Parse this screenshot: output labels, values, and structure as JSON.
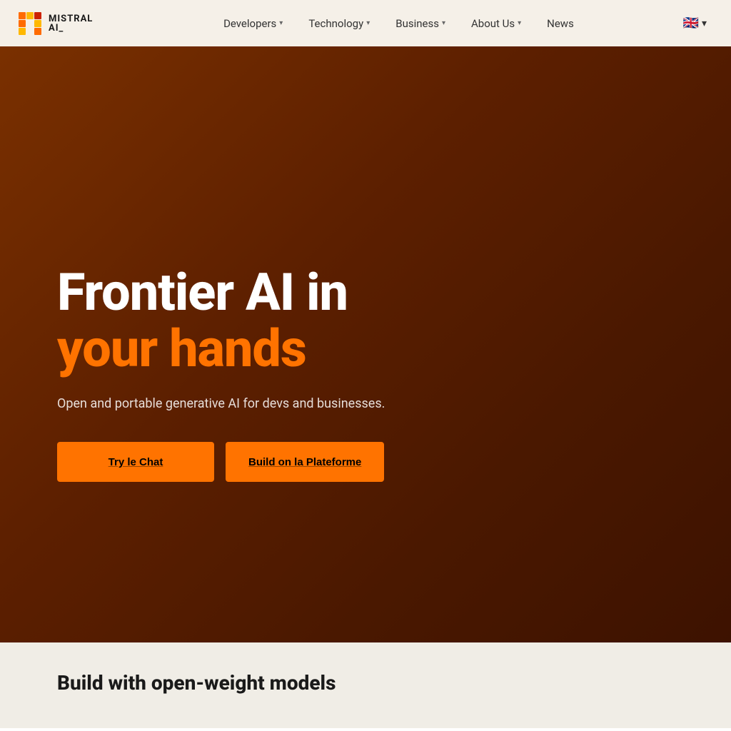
{
  "navbar": {
    "logo": {
      "title": "MISTRAL",
      "subtitle": "AI_"
    },
    "nav_items": [
      {
        "label": "Developers",
        "has_dropdown": true
      },
      {
        "label": "Technology",
        "has_dropdown": true
      },
      {
        "label": "Business",
        "has_dropdown": true
      },
      {
        "label": "About Us",
        "has_dropdown": true
      },
      {
        "label": "News",
        "has_dropdown": false
      }
    ],
    "language": {
      "code": "EN",
      "flag_emoji": "🇬🇧"
    }
  },
  "hero": {
    "title_line1": "Frontier AI in",
    "title_line2": "your hands",
    "subtitle": "Open and portable generative AI for devs and businesses.",
    "btn_primary_label": "Try le Chat",
    "btn_secondary_label": "Build on la Plateforme"
  },
  "bottom_section": {
    "title": "Build with open-weight models"
  }
}
